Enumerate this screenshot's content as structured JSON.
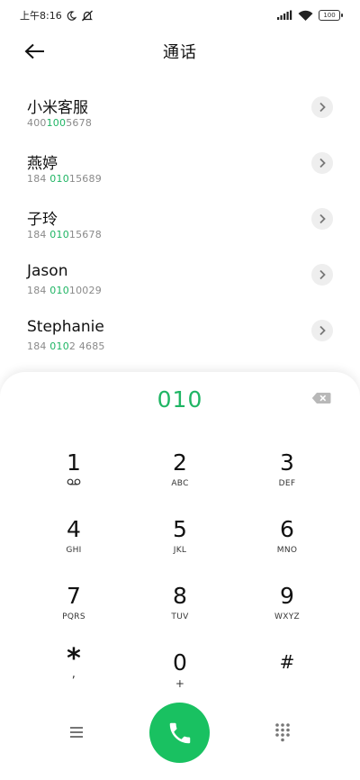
{
  "status_bar": {
    "time": "上午8:16",
    "battery": "100",
    "icons": [
      "moon-icon",
      "mute-bell-icon",
      "signal-icon",
      "wifi-icon",
      "battery-icon"
    ]
  },
  "header": {
    "title": "通话",
    "back_icon": "arrow-left-icon"
  },
  "contacts": [
    {
      "name": "小米客服",
      "number_pre": "400",
      "number_match": "100",
      "number_post": "5678"
    },
    {
      "name": "燕婷",
      "number_pre": "184 ",
      "number_match": "010",
      "number_post": "15689"
    },
    {
      "name": "子玲",
      "number_pre": "184 ",
      "number_match": "010",
      "number_post": "15678"
    },
    {
      "name": "Jason",
      "number_pre": "184 ",
      "number_match": "010",
      "number_post": "10029"
    },
    {
      "name": "Stephanie",
      "number_pre": "184 ",
      "number_match": "010",
      "number_post": "2 4685"
    }
  ],
  "dialpad": {
    "input_value": "010",
    "keys": [
      {
        "digit": "1",
        "sub": "voicemail-icon"
      },
      {
        "digit": "2",
        "sub": "ABC"
      },
      {
        "digit": "3",
        "sub": "DEF"
      },
      {
        "digit": "4",
        "sub": "GHI"
      },
      {
        "digit": "5",
        "sub": "JKL"
      },
      {
        "digit": "6",
        "sub": "MNO"
      },
      {
        "digit": "7",
        "sub": "PQRS"
      },
      {
        "digit": "8",
        "sub": "TUV"
      },
      {
        "digit": "9",
        "sub": "WXYZ"
      },
      {
        "digit": "*",
        "sub": ","
      },
      {
        "digit": "0",
        "sub": "+"
      },
      {
        "digit": "#",
        "sub": ""
      }
    ]
  },
  "bottom_bar": {
    "icons": [
      "menu-icon",
      "phone-icon",
      "dialpad-grid-icon"
    ]
  },
  "colors": {
    "accent": "#1fb564",
    "call_button": "#19c161",
    "detail_button_bg": "#eeeeee"
  }
}
